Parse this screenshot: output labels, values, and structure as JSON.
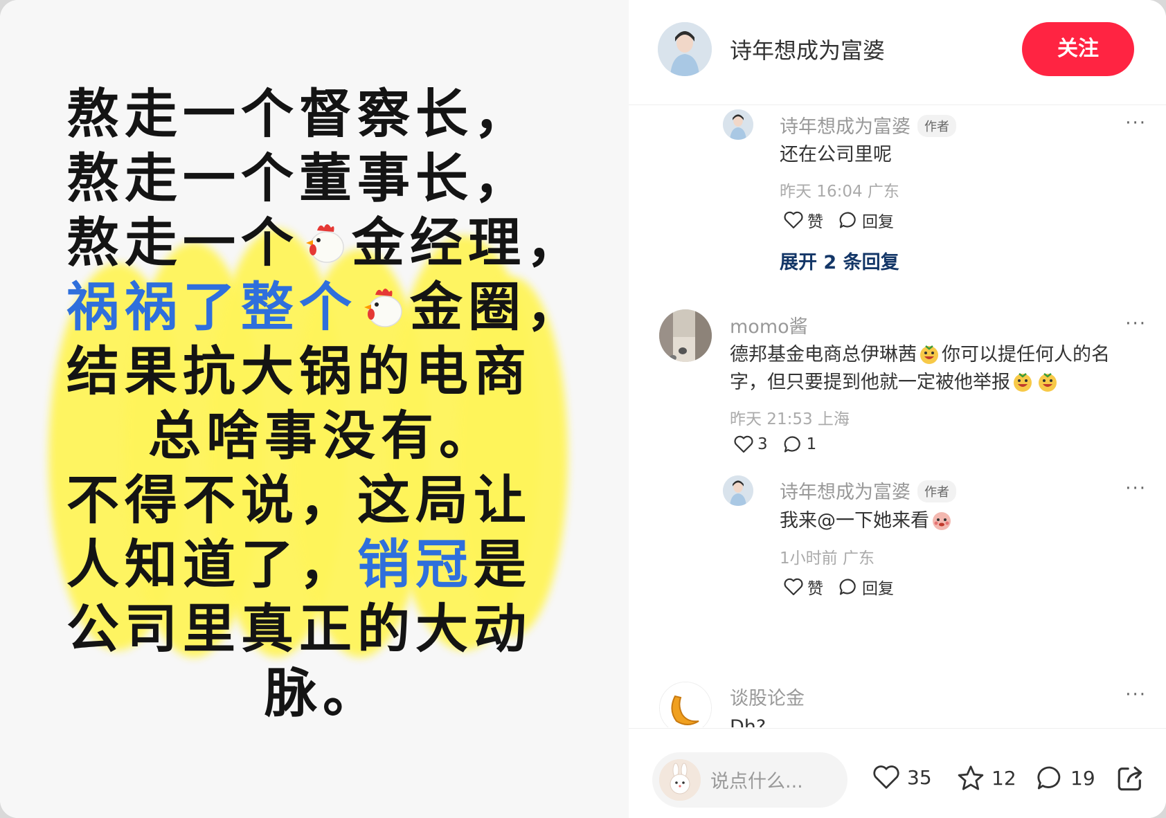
{
  "post": {
    "lines": [
      {
        "parts": [
          {
            "t": "熬走一个督察长，"
          }
        ]
      },
      {
        "parts": [
          {
            "t": "熬走一个董事长，"
          }
        ]
      },
      {
        "parts": [
          {
            "t": "熬走一个"
          },
          {
            "emoji": "chicken"
          },
          {
            "t": "金经理，"
          }
        ]
      },
      {
        "parts": [
          {
            "t": "祸祸了整个",
            "blue": true
          },
          {
            "emoji": "chicken"
          },
          {
            "t": "金圈，"
          }
        ]
      },
      {
        "parts": [
          {
            "t": "结果抗大锅的电商"
          }
        ]
      },
      {
        "parts": [
          {
            "t": "总啥事没有。"
          }
        ],
        "center": true
      },
      {
        "parts": [
          {
            "t": "不得不说，这局让"
          }
        ]
      },
      {
        "parts": [
          {
            "t": "人知道了，"
          },
          {
            "t": "销冠",
            "blue": true
          },
          {
            "t": "是"
          }
        ]
      },
      {
        "parts": [
          {
            "t": "公司里真正的大动"
          }
        ]
      },
      {
        "parts": [
          {
            "t": "脉。"
          }
        ],
        "center": true
      }
    ]
  },
  "header": {
    "author_name": "诗年想成为富婆",
    "follow_label": "关注"
  },
  "comments": {
    "c1": {
      "name": "诗年想成为富婆",
      "tag": "作者",
      "text": "还在公司里呢",
      "meta": "昨天 16:04 广东",
      "like_label": "赞",
      "reply_label": "回复",
      "expand_label": "展开 2 条回复"
    },
    "c2": {
      "name": "momo酱",
      "text_a": "德邦基金电商总伊琳茜",
      "text_b": "你可以提任何人的名",
      "text_c": "字，但只要提到他就一定被他举报",
      "meta": "昨天 21:53 上海",
      "likes": "3",
      "replies": "1"
    },
    "c3": {
      "name": "诗年想成为富婆",
      "tag": "作者",
      "text": "我来@一下她来看",
      "meta": "1小时前 广东",
      "like_label": "赞",
      "reply_label": "回复"
    },
    "c4": {
      "name": "谈股论金",
      "text": "Dh?"
    },
    "more_label": "···"
  },
  "bottom": {
    "input_placeholder": "说点什么...",
    "likes": "35",
    "stars": "12",
    "comments": "19"
  },
  "colors": {
    "accent": "#ff2442",
    "highlight": "#fff45a",
    "blue_text": "#2f6fdc",
    "expand": "#133667"
  },
  "icons": [
    "chicken-icon",
    "heart-icon",
    "comment-icon",
    "star-icon",
    "share-icon",
    "more-icon",
    "grin-emoji-icon",
    "blush-emoji-icon",
    "bunny-avatar",
    "croissant-avatar"
  ]
}
